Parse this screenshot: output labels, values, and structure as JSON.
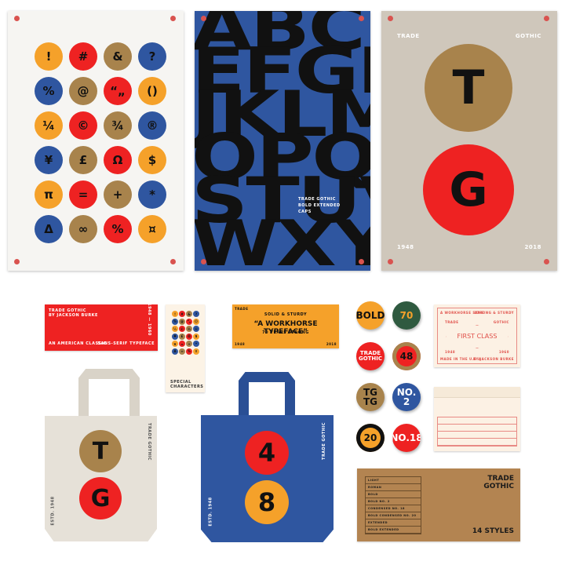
{
  "colors": {
    "orange": "#f5a12a",
    "red": "#ee2222",
    "brown": "#a8834c",
    "blue": "#2f56a0",
    "beige": "#cfc7bb"
  },
  "poster1": {
    "symbols": [
      {
        "c": "!",
        "col": "orange"
      },
      {
        "c": "#",
        "col": "red"
      },
      {
        "c": "&",
        "col": "brown"
      },
      {
        "c": "?",
        "col": "blue"
      },
      {
        "c": "%",
        "col": "blue"
      },
      {
        "c": "@",
        "col": "brown"
      },
      {
        "c": "“„",
        "col": "red"
      },
      {
        "c": "()",
        "col": "orange"
      },
      {
        "c": "¼",
        "col": "orange"
      },
      {
        "c": "©",
        "col": "red"
      },
      {
        "c": "¾",
        "col": "brown"
      },
      {
        "c": "®",
        "col": "blue"
      },
      {
        "c": "¥",
        "col": "blue"
      },
      {
        "c": "£",
        "col": "brown"
      },
      {
        "c": "Ω",
        "col": "red"
      },
      {
        "c": "$",
        "col": "orange"
      },
      {
        "c": "π",
        "col": "orange"
      },
      {
        "c": "=",
        "col": "red"
      },
      {
        "c": "+",
        "col": "brown"
      },
      {
        "c": "*",
        "col": "blue"
      },
      {
        "c": "Δ",
        "col": "blue"
      },
      {
        "c": "∞",
        "col": "brown"
      },
      {
        "c": "%",
        "col": "red"
      },
      {
        "c": "¤",
        "col": "orange"
      }
    ]
  },
  "poster2": {
    "rows": [
      "ABCD",
      "EFGHI",
      "JKLMN",
      "OPQR",
      "STUV",
      "WXYZ"
    ],
    "caption": [
      "TRADE GOTHIC",
      "BOLD EXTENDED",
      "CAPS"
    ]
  },
  "poster3": {
    "top_left": "TRADE",
    "top_right": "GOTHIC",
    "letter1": "T",
    "letter2": "G",
    "year_start": "1948",
    "year_end": "2018"
  },
  "red_card": {
    "title": "TRADE GOTHIC",
    "byline": "BY JACKSON BURKE",
    "years": "1948 — 1960",
    "left": "AN AMERICAN CLASSIC",
    "right": "SANS-SERIF TYPEFACE"
  },
  "special_card": {
    "label": "SPECIAL CHARACTERS"
  },
  "orange_card": {
    "corner": "TRADE",
    "line1": "SOLID & STURDY",
    "line2": "“A WORKHORSE TYPEFACE”",
    "line3": "70 YEARS STRONG",
    "year_left": "1948",
    "year_right": "2018"
  },
  "tote_beige": {
    "side": "TRADE GOTHIC",
    "estd": "ESTD. 1948",
    "letter1": "T",
    "letter2": "G"
  },
  "tote_blue": {
    "side": "TRADE GOTHIC",
    "estd": "ESTD. 1948",
    "num1": "4",
    "num2": "8"
  },
  "buttons": [
    {
      "t": "BOLD",
      "col": "orange"
    },
    {
      "t": "70",
      "col": "green"
    },
    {
      "t": "TRADE GOTHIC",
      "col": "red"
    },
    {
      "t": "48",
      "col": "brown"
    },
    {
      "t": "TG TG",
      "col": "brown"
    },
    {
      "t": "NO. 2",
      "col": "blue"
    },
    {
      "t": "20",
      "col": "black"
    },
    {
      "t": "NO.18",
      "col": "red"
    }
  ],
  "first_class": {
    "tl": "A WORKHORSE SANS",
    "tr": "STRONG & STURDY",
    "ml": "TRADE",
    "mr": "GOTHIC",
    "center": "FIRST CLASS",
    "yl": "1948",
    "yr": "1960",
    "bl": "MADE IN THE U.S.A",
    "br": "BY JACKSON BURKE"
  },
  "box": {
    "title1": "TRADE",
    "title2": "GOTHIC",
    "styles": "14 STYLES",
    "list": [
      "LIGHT",
      "ROMAN",
      "BOLD",
      "BOLD NO. 2",
      "CONDENSED NO. 18",
      "BOLD CONDENSED NO. 20",
      "EXTENDED",
      "BOLD EXTENDED"
    ]
  }
}
